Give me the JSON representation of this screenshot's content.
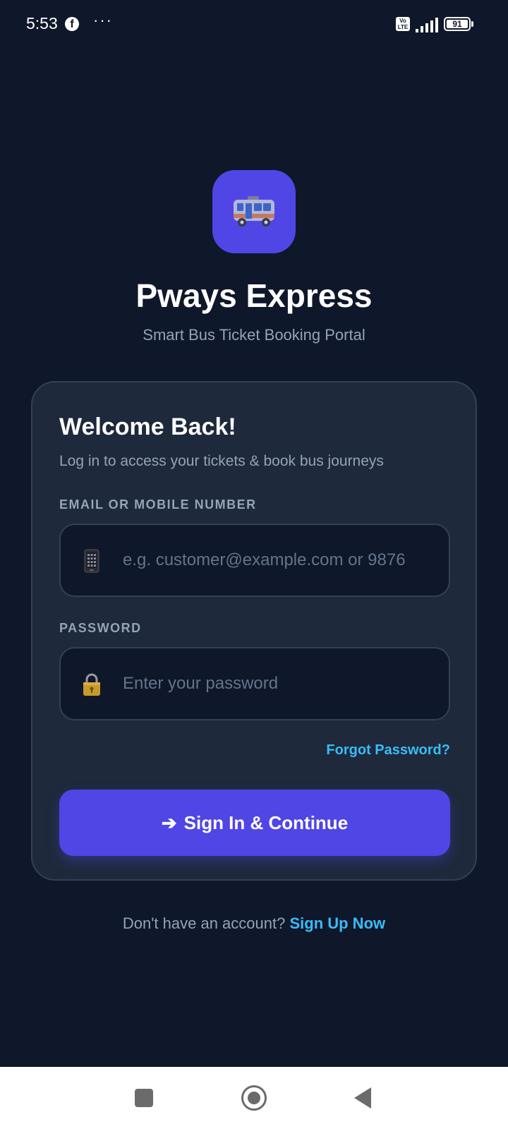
{
  "status_bar": {
    "time": "5:53",
    "facebook_icon": "facebook-icon",
    "more_dots": "···",
    "volte_label": "Vo LTE",
    "battery_level": "91"
  },
  "app": {
    "logo_icon": "bus-icon",
    "title": "Pways Express",
    "subtitle": "Smart Bus Ticket Booking Portal"
  },
  "login": {
    "heading": "Welcome Back!",
    "subheading": "Log in to access your tickets & book bus journeys",
    "email_label": "EMAIL OR MOBILE NUMBER",
    "email_icon": "mobile-phone-icon",
    "email_placeholder": "e.g. customer@example.com or 9876",
    "email_value": "",
    "password_label": "PASSWORD",
    "password_icon": "lock-icon",
    "password_placeholder": "Enter your password",
    "password_value": "",
    "forgot_password": "Forgot Password?",
    "submit_arrow": "➔",
    "submit_label": "Sign In & Continue"
  },
  "signup": {
    "prompt": "Don't have an account?",
    "link": "Sign Up Now"
  },
  "nav": {
    "recents": "recents-icon",
    "home": "home-icon",
    "back": "back-icon"
  },
  "colors": {
    "background": "#0f172a",
    "card": "#1e293b",
    "accent": "#4f46e5",
    "link": "#38bdf8",
    "muted_text": "#94a3b8"
  }
}
